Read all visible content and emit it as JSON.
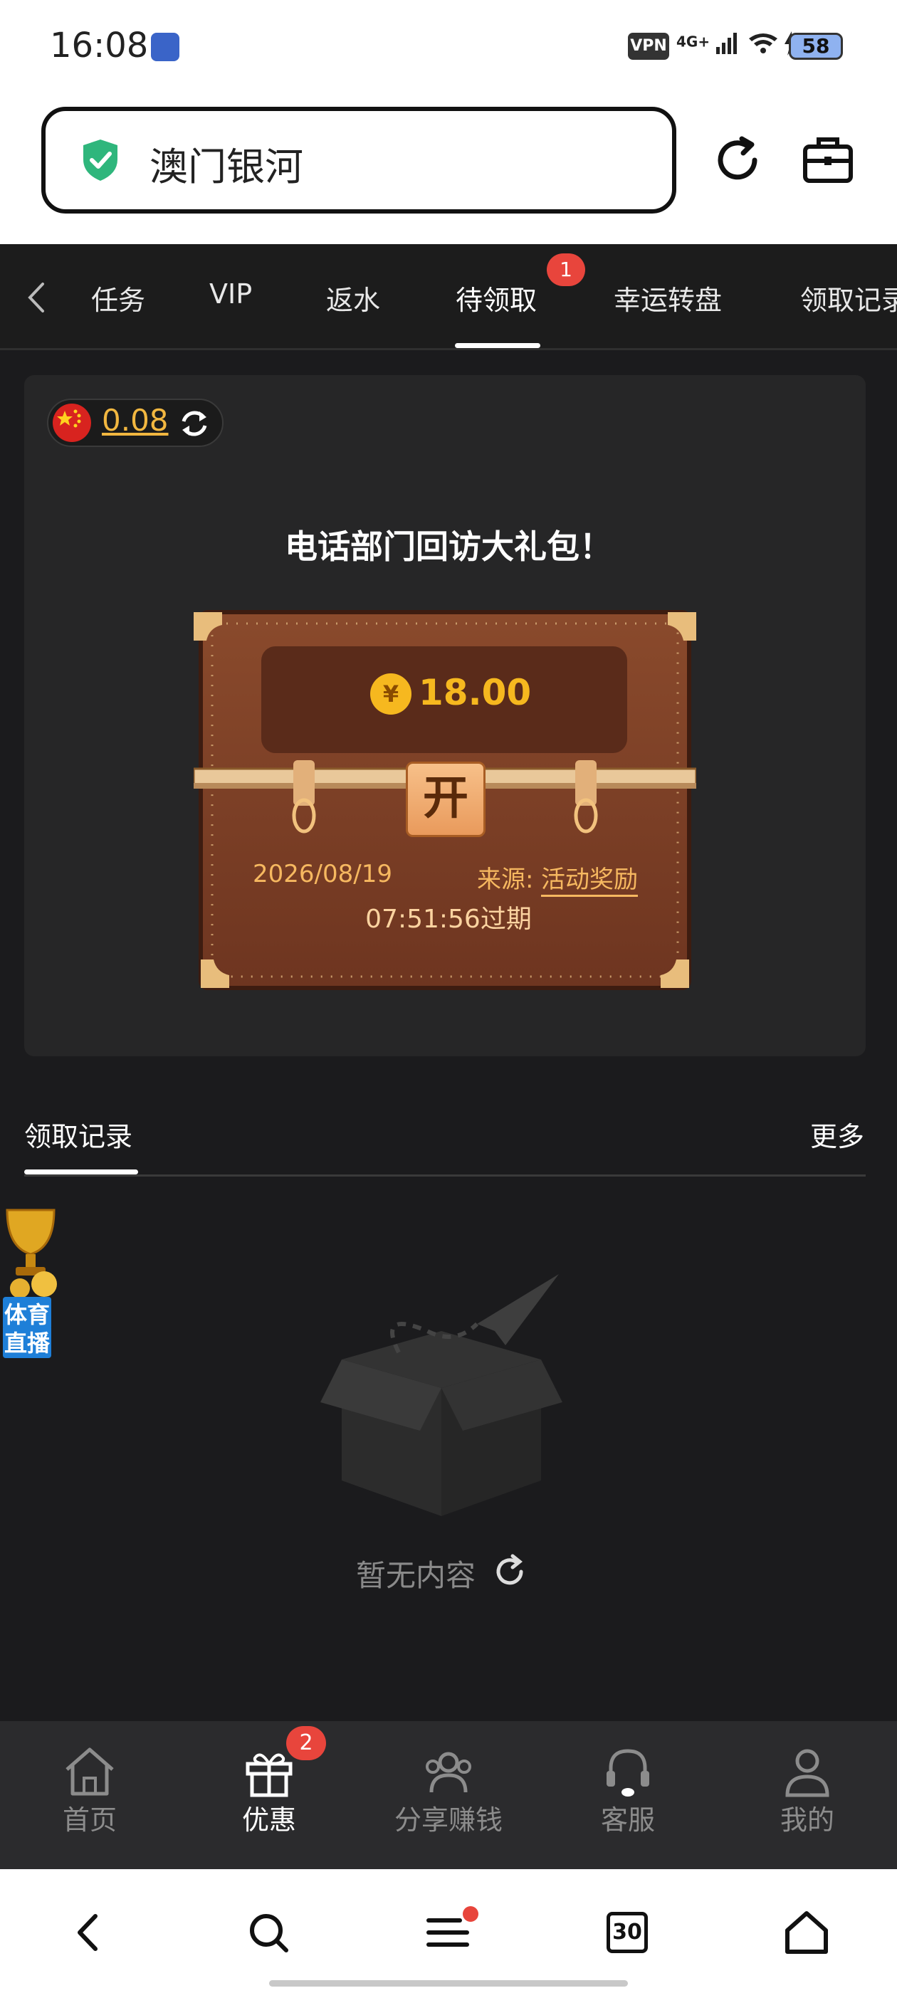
{
  "status_bar": {
    "time": "16:08",
    "vpn": "VPN",
    "network": "4G+",
    "battery": "58"
  },
  "browser": {
    "site_title": "澳门银河"
  },
  "tabs": [
    {
      "label": "任务"
    },
    {
      "label": "VIP"
    },
    {
      "label": "返水"
    },
    {
      "label": "待领取",
      "active": true,
      "badge": "1"
    },
    {
      "label": "幸运转盘"
    },
    {
      "label": "领取记录"
    }
  ],
  "balance": {
    "value": "0.08"
  },
  "gift": {
    "title": "电话部门回访大礼包！",
    "currency_symbol": "¥",
    "amount": "18.00",
    "open_label": "开",
    "date": "2026/08/19",
    "source_label": "来源:",
    "source_value": "活动奖励",
    "expire": "07:51:56过期"
  },
  "records": {
    "title": "领取记录",
    "more": "更多",
    "empty_text": "暂无内容"
  },
  "floating": {
    "line1": "体育",
    "line2": "直播"
  },
  "bottom_nav": {
    "items": [
      {
        "label": "首页",
        "icon": "home-icon"
      },
      {
        "label": "优惠",
        "icon": "gift-icon",
        "active": true,
        "badge": "2"
      },
      {
        "label": "分享赚钱",
        "icon": "share-users-icon"
      },
      {
        "label": "客服",
        "icon": "headset-icon"
      },
      {
        "label": "我的",
        "icon": "user-icon"
      }
    ]
  },
  "system_nav": {
    "tabs_count": "30"
  },
  "colors": {
    "accent_gold": "#f6b81f",
    "badge_red": "#e8453c",
    "background": "#1b1b1d",
    "card": "#262627"
  }
}
